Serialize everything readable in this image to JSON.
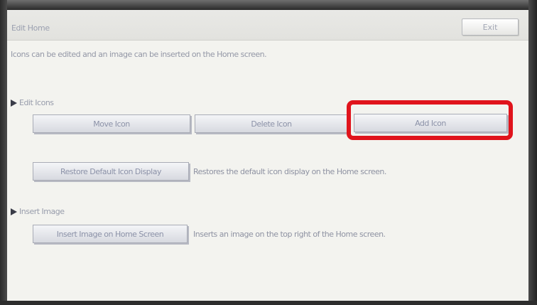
{
  "header": {
    "title": "Edit Home",
    "exit_label": "Exit"
  },
  "description": "Icons can be edited and an image can be inserted on the Home screen.",
  "edit_icons": {
    "heading": "Edit Icons",
    "move_label": "Move Icon",
    "delete_label": "Delete Icon",
    "add_label": "Add Icon",
    "restore_label": "Restore Default Icon Display",
    "restore_help": "Restores the default icon display on the Home screen."
  },
  "insert_image": {
    "heading": "Insert Image",
    "insert_label": "Insert Image on Home Screen",
    "insert_help": "Inserts an image on the top right of the Home screen."
  },
  "colors": {
    "highlight": "#e0141c"
  }
}
